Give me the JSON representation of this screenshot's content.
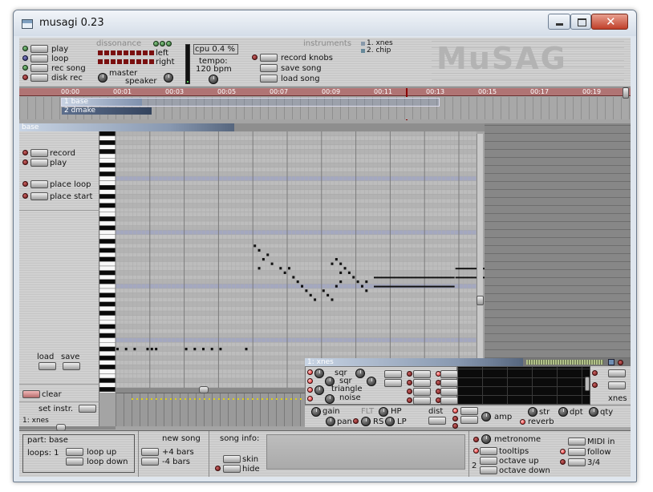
{
  "window": {
    "title": "musagi 0.23"
  },
  "transport": {
    "play": "play",
    "loop": "loop",
    "rec_song": "rec song",
    "disk_rec": "disk rec",
    "dissonance": "dissonance",
    "left": "left",
    "right": "right",
    "master": "master",
    "speaker": "speaker",
    "cpu": "cpu 0.4 %",
    "tempo_label": "tempo:",
    "tempo_value": "120 bpm",
    "record_knobs": "record knobs",
    "save_song": "save song",
    "load_song": "load song"
  },
  "instruments": {
    "header": "instruments",
    "list": [
      "1. xnes",
      "2. chip"
    ]
  },
  "timeline": {
    "ticks": [
      "00:00",
      "00:01",
      "00:03",
      "00:05",
      "00:07",
      "00:09",
      "00:11",
      "00:13",
      "00:15",
      "00:17",
      "00:19"
    ],
    "tracks": [
      "1 base",
      "2 dmake"
    ]
  },
  "part_editor": {
    "title": "base",
    "record": "record",
    "play": "play",
    "place_loop": "place loop",
    "place_start": "place start",
    "load": "load",
    "save": "save",
    "clear": "clear",
    "set_instr": "set instr.",
    "instr_name": "1: xnes"
  },
  "synth": {
    "title": "1: xnes",
    "sqr1": "sqr",
    "sqr2": "sqr",
    "triangle": "triangle",
    "noise": "noise",
    "gain": "gain",
    "pan": "pan",
    "flt": "FLT",
    "hp": "HP",
    "rs": "RS",
    "lp": "LP",
    "dist": "dist",
    "amp": "amp",
    "str": "str",
    "dpt": "dpt",
    "qty": "qty",
    "reverb": "reverb",
    "name": "xnes"
  },
  "bottom": {
    "part": "part: base",
    "loops": "loops: 1",
    "loop_up": "loop up",
    "loop_down": "loop down",
    "new_song": "new song",
    "plus4": "+4 bars",
    "minus4": "-4 bars",
    "song_info": "song info:",
    "skin": "skin",
    "hide": "hide",
    "metronome": "metronome",
    "tooltips": "tooltips",
    "octave_up": "octave up",
    "octave_down": "octave down",
    "octave_value": "2",
    "midi_in": "MIDI in",
    "follow": "follow",
    "three_four": "3/4"
  },
  "colors": {
    "accent_red": "#7a1010",
    "led_on": "#e01010",
    "panel_blue": "#8898b0"
  },
  "notes": [
    {
      "pitch": 46,
      "start": 0,
      "len": 1
    },
    {
      "pitch": 46,
      "start": 2,
      "len": 1
    },
    {
      "pitch": 46,
      "start": 4,
      "len": 1
    },
    {
      "pitch": 46,
      "start": 7,
      "len": 1
    },
    {
      "pitch": 46,
      "start": 8,
      "len": 1
    },
    {
      "pitch": 46,
      "start": 9,
      "len": 1
    },
    {
      "pitch": 46,
      "start": 16,
      "len": 1
    },
    {
      "pitch": 46,
      "start": 18,
      "len": 1
    },
    {
      "pitch": 46,
      "start": 20,
      "len": 1
    },
    {
      "pitch": 46,
      "start": 22,
      "len": 1
    },
    {
      "pitch": 46,
      "start": 24,
      "len": 1
    },
    {
      "pitch": 46,
      "start": 30,
      "len": 1
    },
    {
      "pitch": 69,
      "start": 32,
      "len": 1
    },
    {
      "pitch": 68,
      "start": 33,
      "len": 1
    },
    {
      "pitch": 67,
      "start": 35,
      "len": 1
    },
    {
      "pitch": 66,
      "start": 34,
      "len": 1
    },
    {
      "pitch": 65,
      "start": 36,
      "len": 1
    },
    {
      "pitch": 64,
      "start": 33,
      "len": 1
    },
    {
      "pitch": 64,
      "start": 38,
      "len": 1
    },
    {
      "pitch": 64,
      "start": 40,
      "len": 1
    },
    {
      "pitch": 63,
      "start": 39,
      "len": 1
    },
    {
      "pitch": 62,
      "start": 41,
      "len": 1
    },
    {
      "pitch": 61,
      "start": 42,
      "len": 1
    },
    {
      "pitch": 60,
      "start": 43,
      "len": 1
    },
    {
      "pitch": 59,
      "start": 44,
      "len": 1
    },
    {
      "pitch": 58,
      "start": 45,
      "len": 1
    },
    {
      "pitch": 57,
      "start": 46,
      "len": 1
    },
    {
      "pitch": 57,
      "start": 50,
      "len": 1
    },
    {
      "pitch": 58,
      "start": 49,
      "len": 1
    },
    {
      "pitch": 59,
      "start": 48,
      "len": 1
    },
    {
      "pitch": 60,
      "start": 51,
      "len": 1
    },
    {
      "pitch": 61,
      "start": 52,
      "len": 1
    },
    {
      "pitch": 64,
      "start": 53,
      "len": 1
    },
    {
      "pitch": 63,
      "start": 54,
      "len": 1
    },
    {
      "pitch": 62,
      "start": 55,
      "len": 1
    },
    {
      "pitch": 61,
      "start": 56,
      "len": 1
    },
    {
      "pitch": 60,
      "start": 57,
      "len": 1
    },
    {
      "pitch": 59,
      "start": 58,
      "len": 1
    },
    {
      "pitch": 65,
      "start": 50,
      "len": 1
    },
    {
      "pitch": 66,
      "start": 51,
      "len": 1
    },
    {
      "pitch": 65,
      "start": 52,
      "len": 1
    },
    {
      "pitch": 63,
      "start": 52,
      "len": 1
    },
    {
      "pitch": 61,
      "start": 58,
      "len": 1
    },
    {
      "pitch": 62,
      "start": 60,
      "len": 19
    },
    {
      "pitch": 62,
      "start": 79,
      "len": 8
    },
    {
      "pitch": 60,
      "start": 60,
      "len": 19
    },
    {
      "pitch": 64,
      "start": 79,
      "len": 8
    }
  ]
}
